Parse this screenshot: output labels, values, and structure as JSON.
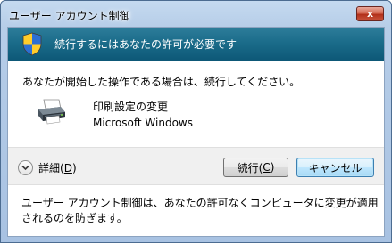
{
  "window": {
    "title": "ユーザー アカウント制御",
    "close_label": "x"
  },
  "banner": {
    "text": "続行するにはあなたの許可が必要です",
    "icon": "shield-icon"
  },
  "body": {
    "description": "あなたが開始した操作である場合は、続行してください。",
    "program_name": "印刷設定の変更",
    "publisher": "Microsoft Windows",
    "program_icon": "printer-icon"
  },
  "buttons": {
    "details_prefix": "詳細(",
    "details_key": "D",
    "details_suffix": ")",
    "continue_prefix": "続行(",
    "continue_key": "C",
    "continue_suffix": ")",
    "cancel": "キャンセル"
  },
  "footer": {
    "text": "ユーザー アカウント制御は、あなたの許可なくコンピュータに変更が適用されるのを防ぎます。"
  },
  "colors": {
    "banner": "#196a88",
    "frame": "#b6cde8",
    "close": "#c9543d"
  }
}
